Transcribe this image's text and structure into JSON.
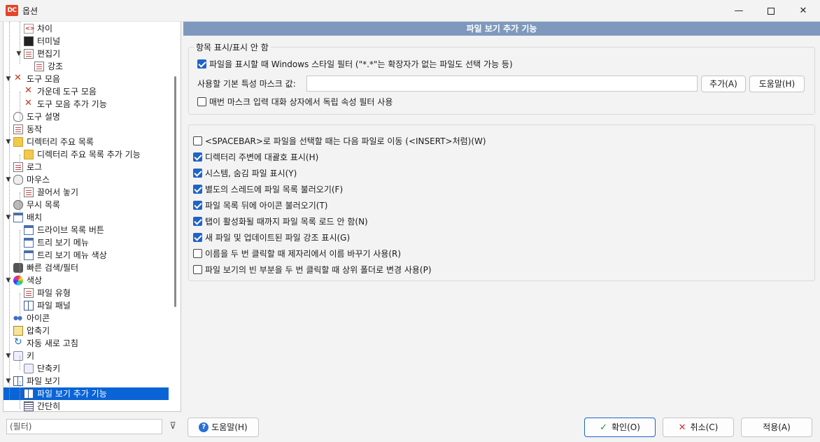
{
  "window": {
    "title": "옵션",
    "app_logo": "DC",
    "controls": {
      "minimize": "—",
      "close": "✕"
    }
  },
  "tree": {
    "items": [
      {
        "label": "차이",
        "icon": "diff-icon",
        "level": 2,
        "expander": ""
      },
      {
        "label": "터미널",
        "icon": "terminal-icon",
        "level": 2,
        "expander": ""
      },
      {
        "label": "편집기",
        "icon": "editor-icon",
        "level": 2,
        "expander": "▼"
      },
      {
        "label": "강조",
        "icon": "document-icon",
        "level": 3,
        "expander": ""
      },
      {
        "label": "도구 모음",
        "icon": "tools-icon",
        "level": 1,
        "expander": "▼"
      },
      {
        "label": "가운데 도구 모음",
        "icon": "tools-icon",
        "level": 2,
        "expander": ""
      },
      {
        "label": "도구 모음 추가 기능",
        "icon": "tools-icon",
        "level": 2,
        "expander": ""
      },
      {
        "label": "도구 설명",
        "icon": "bulb-icon",
        "level": 1,
        "expander": ""
      },
      {
        "label": "동작",
        "icon": "document-icon",
        "level": 1,
        "expander": ""
      },
      {
        "label": "디렉터리 주요 목록",
        "icon": "folder-icon",
        "level": 1,
        "expander": "▼"
      },
      {
        "label": "디렉터리 주요 목록 추가 기능",
        "icon": "folder-icon",
        "level": 2,
        "expander": ""
      },
      {
        "label": "로그",
        "icon": "document-icon",
        "level": 1,
        "expander": ""
      },
      {
        "label": "마우스",
        "icon": "mouse-icon",
        "level": 1,
        "expander": "▼"
      },
      {
        "label": "끌어서 놓기",
        "icon": "document-icon",
        "level": 2,
        "expander": ""
      },
      {
        "label": "무시 목록",
        "icon": "gear-icon",
        "level": 1,
        "expander": ""
      },
      {
        "label": "배치",
        "icon": "window-icon",
        "level": 1,
        "expander": "▼"
      },
      {
        "label": "드라이브 목록 버튼",
        "icon": "window-icon",
        "level": 2,
        "expander": ""
      },
      {
        "label": "트리 보기 메뉴",
        "icon": "window-icon",
        "level": 2,
        "expander": ""
      },
      {
        "label": "트리 보기 메뉴 색상",
        "icon": "window-icon",
        "level": 2,
        "expander": ""
      },
      {
        "label": "빠른 검색/필터",
        "icon": "binoculars-icon",
        "level": 1,
        "expander": ""
      },
      {
        "label": "색상",
        "icon": "color-wheel-icon",
        "level": 1,
        "expander": "▼"
      },
      {
        "label": "파일 유형",
        "icon": "document-icon",
        "level": 2,
        "expander": ""
      },
      {
        "label": "파일 패널",
        "icon": "panel-icon",
        "level": 2,
        "expander": ""
      },
      {
        "label": "아이콘",
        "icon": "footprints-icon",
        "level": 1,
        "expander": ""
      },
      {
        "label": "압축기",
        "icon": "archive-icon",
        "level": 1,
        "expander": ""
      },
      {
        "label": "자동 새로 고침",
        "icon": "refresh-icon",
        "level": 1,
        "expander": ""
      },
      {
        "label": "키",
        "icon": "keyboard-icon",
        "level": 1,
        "expander": "▼"
      },
      {
        "label": "단축키",
        "icon": "keyboard-icon",
        "level": 2,
        "expander": ""
      },
      {
        "label": "파일 보기",
        "icon": "panel-icon",
        "level": 1,
        "expander": "▼"
      },
      {
        "label": "파일 보기 추가 기능",
        "icon": "panel-icon",
        "level": 2,
        "expander": "",
        "selected": true
      },
      {
        "label": "간단히",
        "icon": "grid-icon",
        "level": 2,
        "expander": ""
      }
    ]
  },
  "filter": {
    "placeholder": "(필터)",
    "clear_icon": "⊽"
  },
  "page": {
    "header": "파일 보기 추가 기능",
    "group1": {
      "title": "항목 표시/표시 안 함",
      "windows_filter": {
        "label": "파일을 표시할 때 Windows 스타일 필터 (\"*.*\"는 확장자가 없는 파일도 선택 가능 등)",
        "checked": true
      },
      "mask_label": "사용할 기본 특성 마스크 값:",
      "mask_value": "",
      "add_button": "추가(A)",
      "help_button": "도움말(H)",
      "independent_filter": {
        "label": "매번 마스크 입력 대화 상자에서 독립 속성 필터 사용",
        "checked": false
      }
    },
    "options": [
      {
        "label": "<SPACEBAR>로 파일을 선택할 때는 다음 파일로 이동 (<INSERT>처럼)(W)",
        "checked": false
      },
      {
        "label": "디렉터리 주변에 대괄호 표시(H)",
        "checked": true
      },
      {
        "label": "시스템, 숨김 파일 표시(Y)",
        "checked": true
      },
      {
        "label": "별도의 스레드에 파일 목록 불러오기(F)",
        "checked": true
      },
      {
        "label": "파일 목록 뒤에 아이콘 불러오기(T)",
        "checked": true
      },
      {
        "label": "탭이 활성화될 때까지 파일 목록 로드 안 함(N)",
        "checked": true
      },
      {
        "label": "새 파일 및 업데이트된 파일 강조 표시(G)",
        "checked": true
      },
      {
        "label": "이름을 두 번 클릭할 때 제자리에서 이름 바꾸기 사용(R)",
        "checked": false
      },
      {
        "label": "파일 보기의 빈 부분을 두 번 클릭할 때 상위 폴더로 변경 사용(P)",
        "checked": false
      }
    ]
  },
  "footer": {
    "help_button": "도움말(H)",
    "ok_button": "확인(O)",
    "cancel_button": "취소(C)",
    "apply_button": "적용(A)"
  }
}
